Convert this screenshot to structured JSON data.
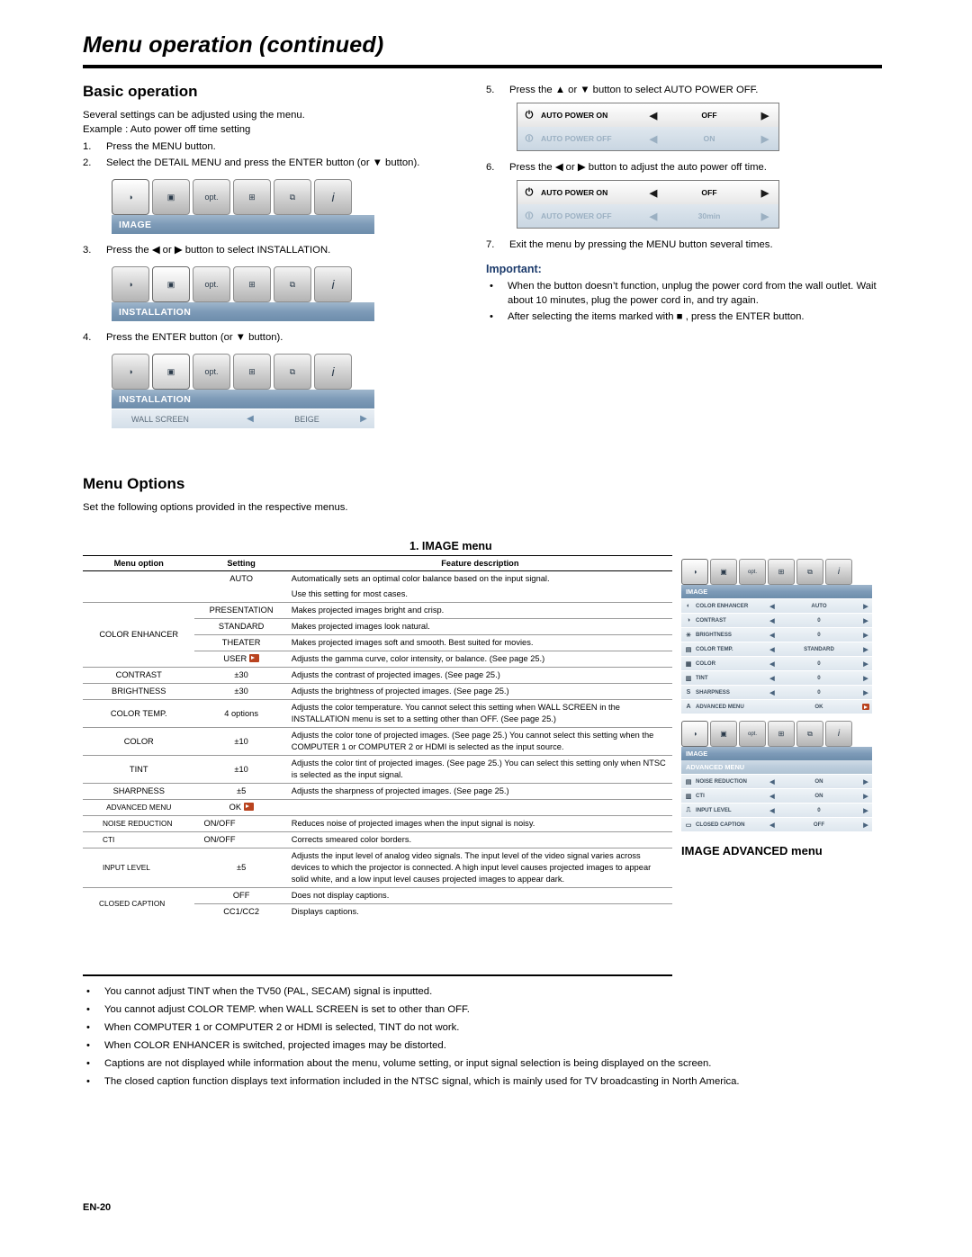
{
  "header": {
    "title": "Menu operation (continued)"
  },
  "left": {
    "section_title": "Basic operation",
    "intro1": "Several settings can be adjusted using the menu.",
    "intro2": "Example : Auto power off time setting",
    "steps": [
      {
        "num": "1.",
        "text": "Press the MENU button."
      },
      {
        "num": "2.",
        "text": "Select the DETAIL MENU and press the ENTER button  (or ▼ button)."
      },
      {
        "num": "3.",
        "text": "Press the ◀ or ▶ button to select INSTALLATION."
      },
      {
        "num": "4.",
        "text": "Press the ENTER button (or ▼ button)."
      }
    ],
    "osd1": {
      "label": "IMAGE"
    },
    "osd2": {
      "label": "INSTALLATION"
    },
    "osd3": {
      "label": "INSTALLATION",
      "row_label": "WALL SCREEN",
      "row_value": "BEIGE"
    }
  },
  "right": {
    "steps": [
      {
        "num": "5.",
        "text": "Press the ▲ or ▼ button to select AUTO POWER OFF."
      },
      {
        "num": "6.",
        "text": "Press the ◀ or ▶ button to adjust the auto power off time."
      },
      {
        "num": "7.",
        "text": "Exit the menu by pressing the MENU button several times."
      }
    ],
    "apbox1": {
      "row1_label": "AUTO POWER ON",
      "row1_value": "OFF",
      "row2_label": "AUTO POWER OFF",
      "row2_value": "ON"
    },
    "apbox2": {
      "row1_label": "AUTO POWER ON",
      "row1_value": "OFF",
      "row2_label": "AUTO POWER OFF",
      "row2_value": "30min"
    },
    "important_title": "Important:",
    "important": [
      "When the button doesn’t function, unplug the power cord from the wall outlet. Wait about 10 minutes, plug the power cord in, and try again.",
      "After selecting the items marked with ■ , press the ENTER button."
    ]
  },
  "menu_options": {
    "title": "Menu Options",
    "intro": "Set the following options provided in the respective menus.",
    "image_menu_heading": "1. IMAGE menu"
  },
  "table": {
    "headers": [
      "Menu option",
      "Setting",
      "Feature description"
    ],
    "rows": [
      {
        "option": "",
        "setting": "AUTO",
        "desc": "Automatically sets an optimal color balance based on the input signal."
      },
      {
        "option": "",
        "setting": "",
        "desc": "Use this setting for most cases."
      },
      {
        "option": "COLOR ENHANCER",
        "setting": "PRESENTATION",
        "desc": "Makes projected images bright and crisp."
      },
      {
        "option": "",
        "setting": "STANDARD",
        "desc": "Makes projected images look natural."
      },
      {
        "option": "",
        "setting": "THEATER",
        "desc": "Makes projected images soft and smooth. Best suited for movies."
      },
      {
        "option": "",
        "setting": "USER",
        "desc": "Adjusts the gamma curve, color intensity, or balance. (See page 25.)"
      },
      {
        "option": "CONTRAST",
        "setting": "±30",
        "desc": "Adjusts the contrast of projected images. (See page 25.)"
      },
      {
        "option": "BRIGHTNESS",
        "setting": "±30",
        "desc": "Adjusts the brightness of projected images. (See page 25.)"
      },
      {
        "option": "COLOR TEMP.",
        "setting": "4 options",
        "desc": "Adjusts the color temperature. You cannot select this setting when WALL SCREEN in the INSTALLATION menu is set to a setting other than OFF. (See page 25.)"
      },
      {
        "option": "COLOR",
        "setting": "±10",
        "desc": "Adjusts the color tone of projected images. (See page 25.) You cannot select this setting when the COMPUTER 1 or COMPUTER 2 or HDMI is selected as the input source."
      },
      {
        "option": "TINT",
        "setting": "±10",
        "desc": "Adjusts the color tint of projected images. (See page 25.) You can select this setting only when NTSC is selected as the input signal."
      },
      {
        "option": "SHARPNESS",
        "setting": "±5",
        "desc": "Adjusts the sharpness of projected images. (See page 25.)"
      },
      {
        "option": "ADVANCED MENU",
        "setting": "OK",
        "desc": ""
      },
      {
        "option": "NOISE REDUCTION",
        "setting": "ON/OFF",
        "desc": "Reduces noise of projected images when the input signal is noisy."
      },
      {
        "option": "CTI",
        "setting": "ON/OFF",
        "desc": "Corrects smeared color borders."
      },
      {
        "option": "INPUT LEVEL",
        "setting": "±5",
        "desc": "Adjusts the input level of analog video signals. The input level of the video signal varies across devices to which the projector is connected. A high input level causes projected images to appear solid white, and a low input level causes projected images to appear dark."
      },
      {
        "option": "CLOSED CAPTION",
        "setting": "OFF",
        "desc": "Does not display captions."
      },
      {
        "option": "",
        "setting": "CC1/CC2",
        "desc": "Displays captions."
      }
    ]
  },
  "osd_right": {
    "menu1": {
      "label": "IMAGE",
      "rows": [
        {
          "label": "COLOR ENHANCER",
          "value": "AUTO"
        },
        {
          "label": "CONTRAST",
          "value": "0"
        },
        {
          "label": "BRIGHTNESS",
          "value": "0"
        },
        {
          "label": "COLOR TEMP.",
          "value": "STANDARD"
        },
        {
          "label": "COLOR",
          "value": "0"
        },
        {
          "label": "TINT",
          "value": "0"
        },
        {
          "label": "SHARPNESS",
          "value": "0"
        },
        {
          "label": "ADVANCED MENU",
          "value": "OK"
        }
      ]
    },
    "menu2": {
      "label1": "IMAGE",
      "label2": "ADVANCED MENU",
      "rows": [
        {
          "label": "NOISE REDUCTION",
          "value": "ON"
        },
        {
          "label": "CTI",
          "value": "ON"
        },
        {
          "label": "INPUT LEVEL",
          "value": "0"
        },
        {
          "label": "CLOSED CAPTION",
          "value": "OFF"
        }
      ]
    },
    "caption": "IMAGE ADVANCED menu"
  },
  "bullets": [
    "You cannot adjust TINT when the TV50 (PAL, SECAM) signal is inputted.",
    "You cannot adjust COLOR TEMP. when WALL SCREEN is set to other than OFF.",
    "When COMPUTER 1 or COMPUTER 2 or HDMI is selected, TINT do not work.",
    "When COLOR ENHANCER is switched, projected images may be distorted.",
    "Captions are not displayed while information about the menu, volume setting, or input signal selection is being displayed on the screen.",
    "The closed caption function displays text information included in the NTSC signal, which is mainly used for TV broadcasting in North America."
  ],
  "footer": {
    "page": "EN-20"
  }
}
